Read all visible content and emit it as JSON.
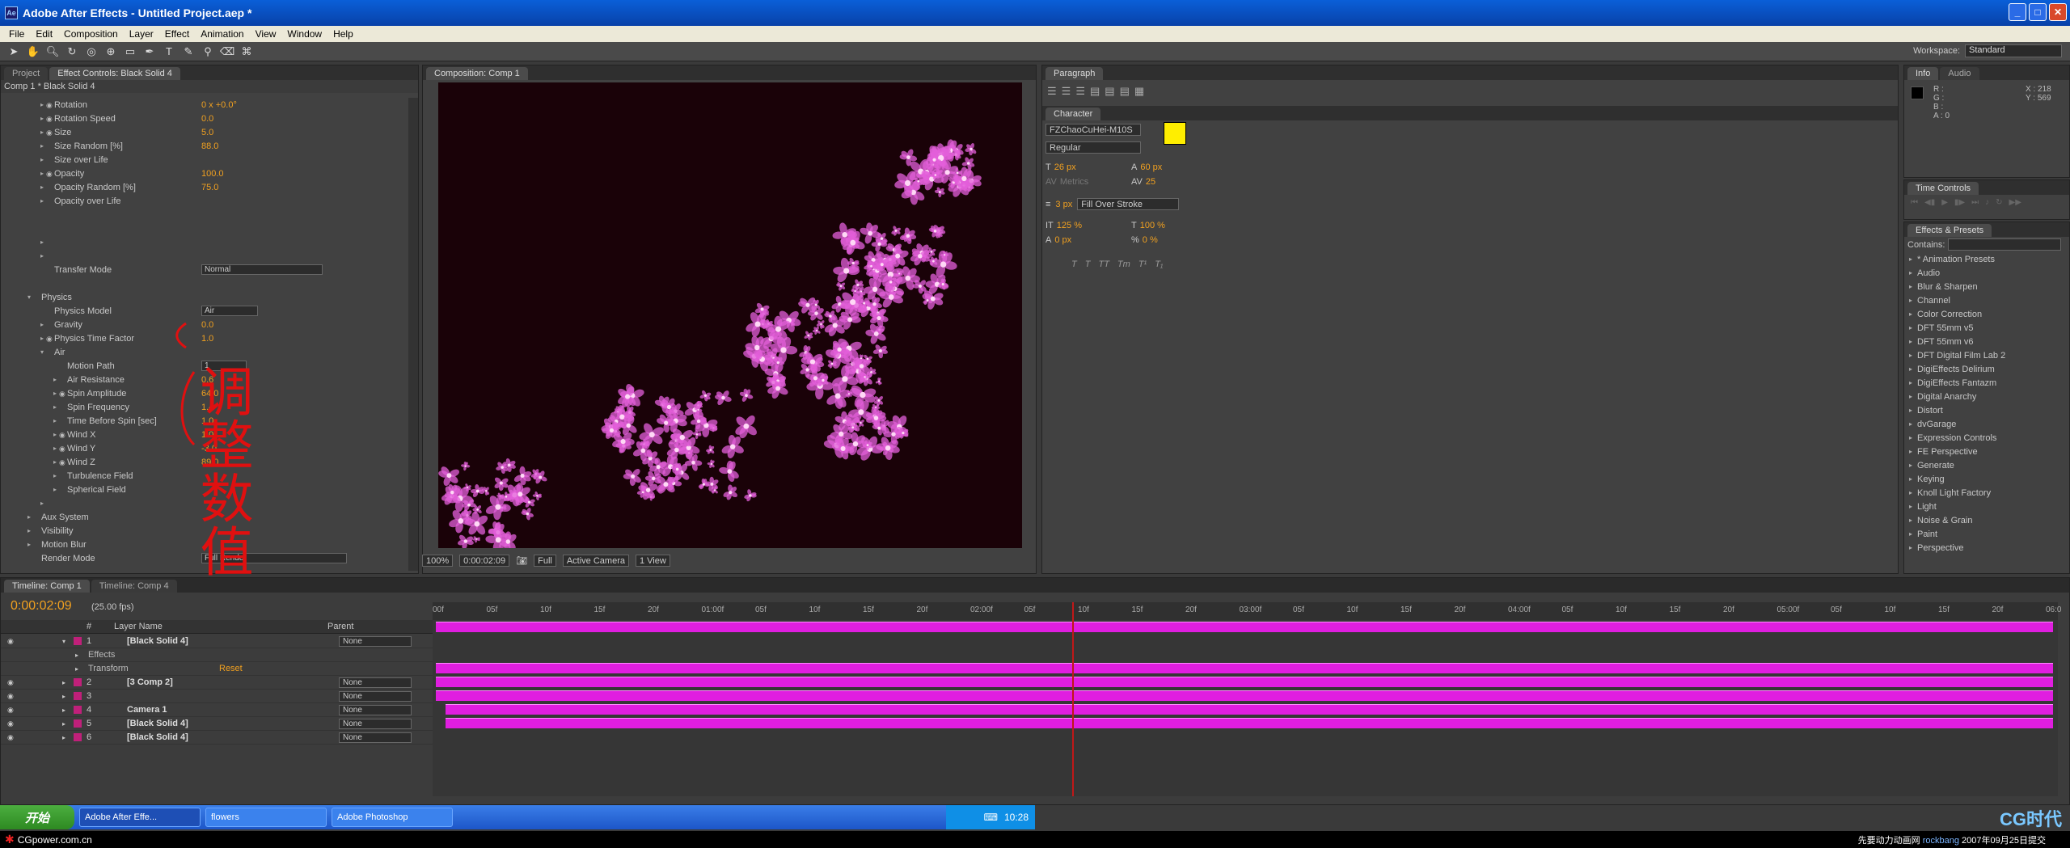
{
  "window": {
    "title": "Adobe After Effects - Untitled Project.aep *"
  },
  "menu": [
    "File",
    "Edit",
    "Composition",
    "Layer",
    "Effect",
    "Animation",
    "View",
    "Window",
    "Help"
  ],
  "workspace": {
    "label": "Workspace:",
    "value": "Standard"
  },
  "left_panel": {
    "tabs": [
      "Project",
      "Effect Controls: Black Solid 4"
    ],
    "header": "Comp 1 * Black Solid 4",
    "rows": [
      {
        "indent": 2,
        "tri": "▸",
        "name": "Rotation",
        "val": "0 x +0.0°",
        "sw": true
      },
      {
        "indent": 2,
        "tri": "▸",
        "name": "Rotation Speed",
        "val": "0.0",
        "sw": true
      },
      {
        "indent": 2,
        "tri": "▸",
        "name": "Size",
        "val": "5.0",
        "sw": true
      },
      {
        "indent": 2,
        "tri": "▸",
        "name": "Size Random [%]",
        "val": "88.0"
      },
      {
        "indent": 2,
        "tri": "▸",
        "name": "Size over Life",
        "val": ""
      },
      {
        "indent": 2,
        "tri": "▸",
        "name": "Opacity",
        "val": "100.0",
        "sw": true
      },
      {
        "indent": 2,
        "tri": "▸",
        "name": "Opacity Random [%]",
        "val": "75.0"
      },
      {
        "indent": 2,
        "tri": "▸",
        "name": "Opacity over Life",
        "val": ""
      },
      {
        "indent": 2,
        "tri": "",
        "name": "",
        "val": "",
        "dim": true
      },
      {
        "indent": 2,
        "tri": "",
        "name": "",
        "val": "",
        "dim": true
      },
      {
        "indent": 2,
        "tri": "▸",
        "name": "",
        "val": "",
        "dim": true
      },
      {
        "indent": 2,
        "tri": "▸",
        "name": "",
        "val": "",
        "dim": true
      },
      {
        "indent": 2,
        "tri": "",
        "name": "Transfer Mode",
        "dd": "Normal",
        "ddw": 150
      },
      {
        "indent": 2,
        "tri": "",
        "name": "",
        "val": "",
        "dim": true
      },
      {
        "indent": 1,
        "tri": "▾",
        "name": "Physics",
        "val": ""
      },
      {
        "indent": 2,
        "tri": "",
        "name": "Physics Model",
        "dd": "Air",
        "ddw": 70
      },
      {
        "indent": 2,
        "tri": "▸",
        "name": "Gravity",
        "val": "0.0"
      },
      {
        "indent": 2,
        "tri": "▸",
        "name": "Physics Time Factor",
        "val": "1.0",
        "sw": true
      },
      {
        "indent": 2,
        "tri": "▾",
        "name": "Air",
        "val": ""
      },
      {
        "indent": 3,
        "tri": "",
        "name": "Motion Path",
        "dd": "1",
        "ddw": 56
      },
      {
        "indent": 3,
        "tri": "▸",
        "name": "Air Resistance",
        "val": "0.6"
      },
      {
        "indent": 3,
        "tri": "▸",
        "name": "Spin Amplitude",
        "val": "64.0",
        "sw": true
      },
      {
        "indent": 3,
        "tri": "▸",
        "name": "Spin Frequency",
        "val": "1.4"
      },
      {
        "indent": 3,
        "tri": "▸",
        "name": "Time Before Spin [sec]",
        "val": "1.0"
      },
      {
        "indent": 3,
        "tri": "▸",
        "name": "Wind X",
        "val": "1.0",
        "sw": true
      },
      {
        "indent": 3,
        "tri": "▸",
        "name": "Wind Y",
        "val": "-3.0",
        "sw": true
      },
      {
        "indent": 3,
        "tri": "▸",
        "name": "Wind Z",
        "val": "89.0",
        "sw": true
      },
      {
        "indent": 3,
        "tri": "▸",
        "name": "Turbulence Field",
        "val": ""
      },
      {
        "indent": 3,
        "tri": "▸",
        "name": "Spherical Field",
        "val": ""
      },
      {
        "indent": 2,
        "tri": "▸",
        "name": "",
        "val": "",
        "dim": true
      },
      {
        "indent": 1,
        "tri": "▸",
        "name": "Aux System",
        "val": ""
      },
      {
        "indent": 1,
        "tri": "▸",
        "name": "Visibility",
        "val": ""
      },
      {
        "indent": 1,
        "tri": "▸",
        "name": "Motion Blur",
        "val": ""
      },
      {
        "indent": 1,
        "tri": "",
        "name": "Render Mode",
        "dd": "Full Render",
        "ddw": 180
      }
    ]
  },
  "annotation": {
    "text": "调整数值",
    "color": "#e01010"
  },
  "comp_panel": {
    "tab": "Composition: Comp 1",
    "zoom": "100%",
    "timecode": "0:00:02:09",
    "resolution": "Full",
    "camera": "Active Camera",
    "view": "1 View"
  },
  "paragraph_panel": {
    "tab": "Paragraph"
  },
  "character_panel": {
    "tab": "Character",
    "font": "FZChaoCuHei-M10S",
    "style": "Regular",
    "size": "26 px",
    "leading": "60 px",
    "kerning": "Metrics",
    "tracking": "25",
    "stroke": "3 px",
    "stroke_mode": "Fill Over Stroke",
    "vscale": "125 %",
    "hscale": "100 %",
    "baseline": "0 px",
    "tsume": "0 %",
    "fill_color": "#ffee00"
  },
  "info_panel": {
    "tabs": [
      "Info",
      "Audio"
    ],
    "r": "R :",
    "g": "G :",
    "b": "B :",
    "a": "A : 0",
    "x": "X : 218",
    "y": "Y : 569"
  },
  "time_controls": {
    "tab": "Time Controls"
  },
  "effects_presets": {
    "tab": "Effects & Presets",
    "contains_label": "Contains:",
    "items": [
      "* Animation Presets",
      "Audio",
      "Blur & Sharpen",
      "Channel",
      "Color Correction",
      "DFT 55mm v5",
      "DFT 55mm v6",
      "DFT Digital Film Lab 2",
      "DigiEffects Delirium",
      "DigiEffects Fantazm",
      "Digital Anarchy",
      "Distort",
      "dvGarage",
      "Expression Controls",
      "FE Perspective",
      "Generate",
      "Keying",
      "Knoll Light Factory",
      "Light",
      "Noise & Grain",
      "Paint",
      "Perspective"
    ]
  },
  "timeline": {
    "tabs": [
      "Timeline: Comp 1",
      "Timeline: Comp 4"
    ],
    "timecode": "0:00:02:09",
    "fps": "(25.00 fps)",
    "col_num": "#",
    "col_layer": "Layer Name",
    "col_parent": "Parent",
    "ruler": [
      "00f",
      "05f",
      "10f",
      "15f",
      "20f",
      "01:00f",
      "05f",
      "10f",
      "15f",
      "20f",
      "02:00f",
      "05f",
      "10f",
      "15f",
      "20f",
      "03:00f",
      "05f",
      "10f",
      "15f",
      "20f",
      "04:00f",
      "05f",
      "10f",
      "15f",
      "20f",
      "05:00f",
      "05f",
      "10f",
      "15f",
      "20f",
      "06:0"
    ],
    "layers": [
      {
        "num": "1",
        "name": "[Black Solid 4]",
        "color": "#c0207a",
        "parent": "None",
        "bar_start": 0
      },
      {
        "num": "",
        "name": "Effects",
        "sub": true
      },
      {
        "num": "",
        "name": "Transform",
        "sub": true,
        "reset": "Reset"
      },
      {
        "num": "2",
        "name": "[3 Comp 2]",
        "color": "#c0207a",
        "parent": "None",
        "bar_start": 0
      },
      {
        "num": "3",
        "name": "",
        "color": "#c0207a",
        "parent": "None",
        "bar_start": 0
      },
      {
        "num": "4",
        "name": "Camera 1",
        "color": "#c0207a",
        "parent": "None",
        "bar_start": 0
      },
      {
        "num": "5",
        "name": "[Black Solid 4]",
        "color": "#c0207a",
        "parent": "None",
        "bar_start": 12
      },
      {
        "num": "6",
        "name": "[Black Solid 4]",
        "color": "#c0207a",
        "parent": "None",
        "bar_start": 12
      }
    ]
  },
  "taskbar": {
    "start": "开始",
    "tasks": [
      "Adobe After Effe...",
      "flowers",
      "Adobe Photoshop"
    ],
    "clock": "10:28"
  },
  "footer": {
    "left": "CGpower.com.cn",
    "right_prefix": "先要动力动画网",
    "right_user": "rockbang",
    "right_date": "2007年09月25日提交",
    "logo": "CG时代"
  }
}
